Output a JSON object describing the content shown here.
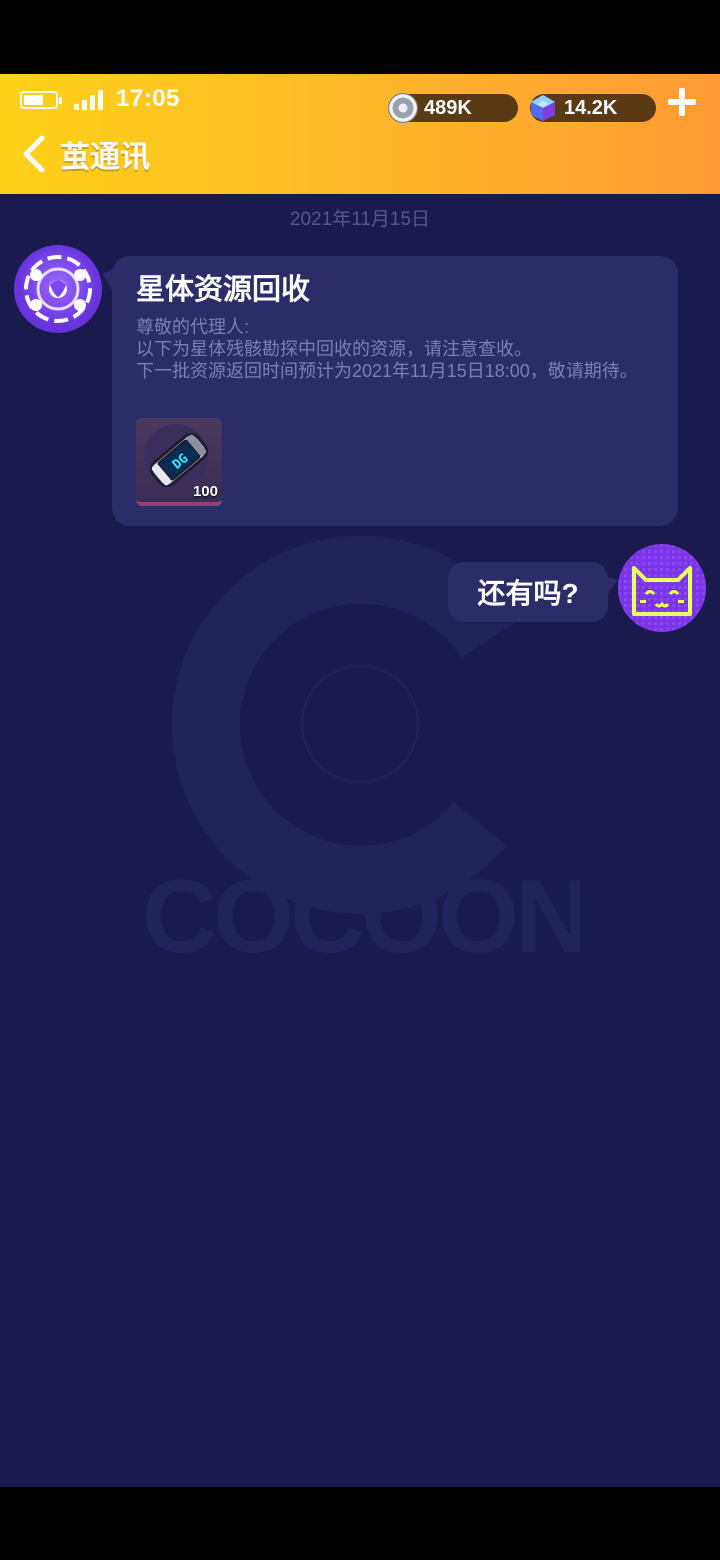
{
  "status_bar": {
    "time": "17:05",
    "battery_icon": "battery-icon",
    "signal_icon": "signal-icon"
  },
  "currencies": {
    "coin": {
      "icon": "coin-icon",
      "value": "489K"
    },
    "gem": {
      "icon": "gem-icon",
      "value": "14.2K"
    }
  },
  "header": {
    "title": "茧通讯",
    "back_icon": "chevron-left-icon"
  },
  "chat": {
    "date": "2021年11月15日",
    "messages": [
      {
        "sender": "npc",
        "title": "星体资源回收",
        "body_lines": [
          "尊敬的代理人:",
          "以下为星体残骸勘探中回收的资源，请注意查收。",
          "下一批资源返回时间预计为2021年11月15日18:00，敬请期待。"
        ],
        "attachment": {
          "icon": "capsule-item-icon",
          "count": "100"
        }
      },
      {
        "sender": "me",
        "text": "还有吗?"
      }
    ]
  },
  "colors": {
    "header_start": "#ffd21a",
    "header_end": "#ff9a35",
    "background": "#1b1a4e",
    "bubble": "#2b2c68",
    "body_text": "#7b7fb6",
    "date_text": "#565785"
  }
}
